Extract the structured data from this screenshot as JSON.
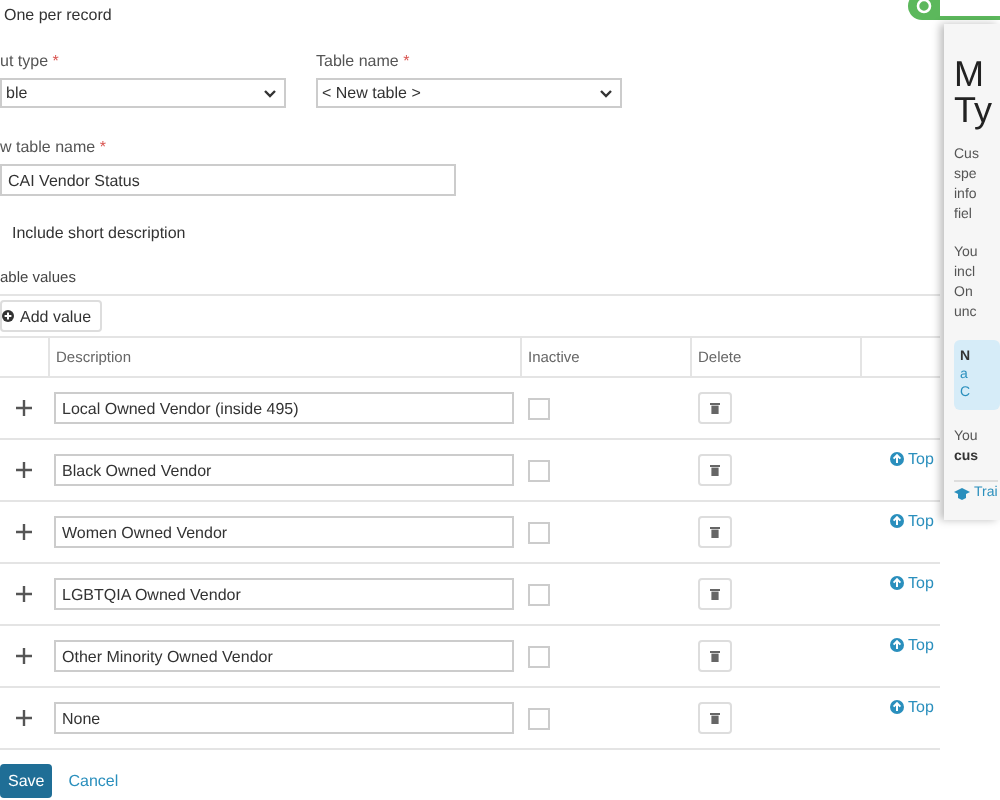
{
  "top_option": {
    "label": "One per record"
  },
  "fields_row": [
    {
      "label": "ut type",
      "required_mark": "*",
      "value": "ble",
      "kind": "select"
    },
    {
      "label": "Table name",
      "required_mark": "*",
      "value": "< New table >",
      "kind": "select"
    }
  ],
  "new_table_name": {
    "label": "w table name",
    "required_mark": "*",
    "value": "CAI Vendor Status"
  },
  "include_short_description": {
    "label": "Include short description"
  },
  "table_values": {
    "title": "able values",
    "add_button": "Add value",
    "columns": [
      "Description",
      "Inactive",
      "Delete"
    ],
    "rows": [
      {
        "description": "Local Owned Vendor (inside 495)",
        "inactive": false
      },
      {
        "description": "Black Owned Vendor",
        "inactive": false,
        "top_link": "Top"
      },
      {
        "description": "Women Owned Vendor",
        "inactive": false,
        "top_link": "Top"
      },
      {
        "description": "LGBTQIA Owned Vendor",
        "inactive": false,
        "top_link": "Top"
      },
      {
        "description": "Other Minority Owned Vendor",
        "inactive": false,
        "top_link": "Top"
      },
      {
        "description": "None",
        "inactive": false,
        "top_link": "Top"
      }
    ]
  },
  "actions": {
    "save": "Save",
    "cancel": "Cancel"
  },
  "help_panel": {
    "title_lines": [
      "M",
      "Ty"
    ],
    "paragraphs": [
      [
        "Cus",
        "spe",
        "info",
        "fiel"
      ],
      [
        "You",
        "incl",
        "On",
        "unc"
      ]
    ],
    "note": [
      "N",
      "a",
      "C"
    ],
    "footer_lines": [
      "You",
      "cus"
    ],
    "link": "Trai"
  }
}
